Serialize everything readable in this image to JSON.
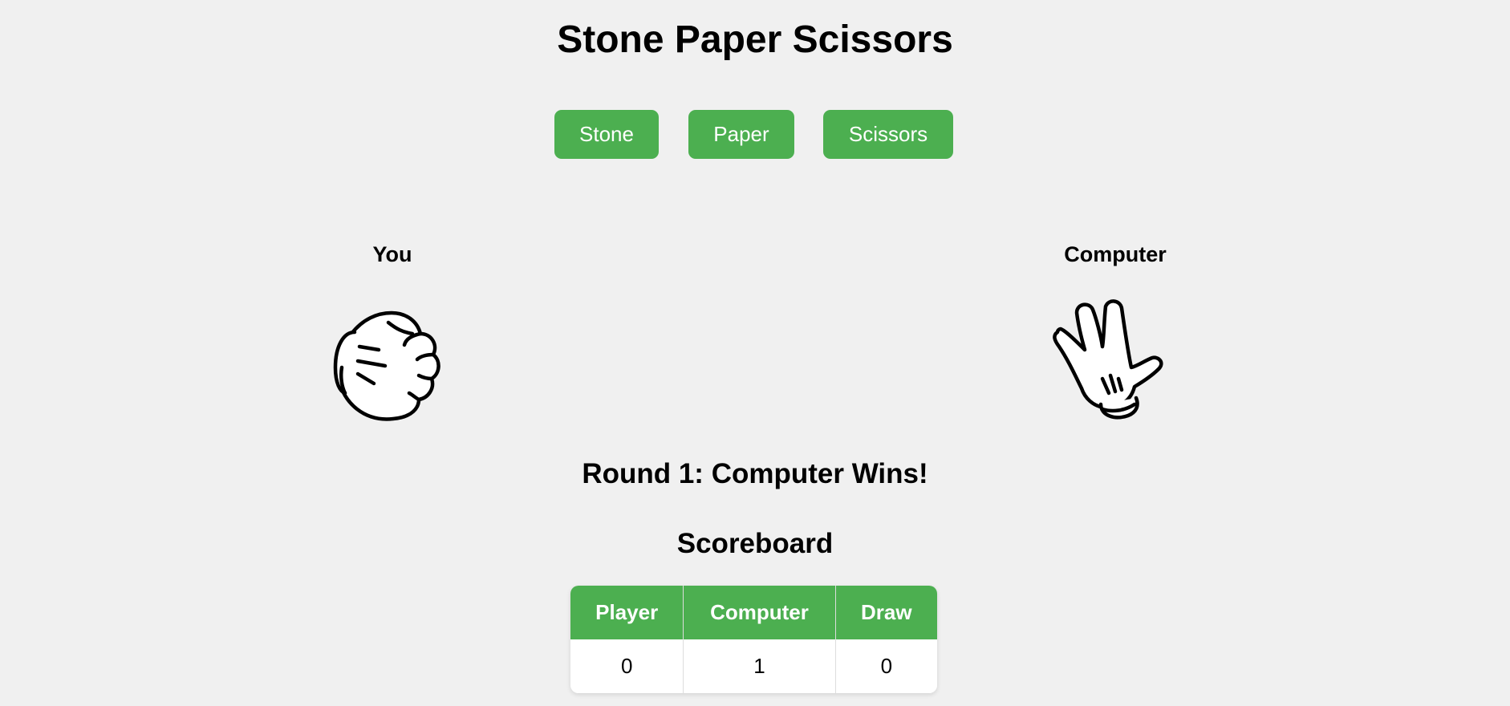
{
  "title": "Stone Paper Scissors",
  "choices": {
    "stone": "Stone",
    "paper": "Paper",
    "scissors": "Scissors"
  },
  "player": {
    "label": "You",
    "hand_icon": "fist-stone-icon"
  },
  "computer": {
    "label": "Computer",
    "hand_icon": "scissors-hand-icon"
  },
  "result": "Round 1: Computer Wins!",
  "scoreboard": {
    "title": "Scoreboard",
    "headers": [
      "Player",
      "Computer",
      "Draw"
    ],
    "values": [
      "0",
      "1",
      "0"
    ]
  },
  "colors": {
    "accent": "#4caf50",
    "background": "#f0f0f0"
  }
}
